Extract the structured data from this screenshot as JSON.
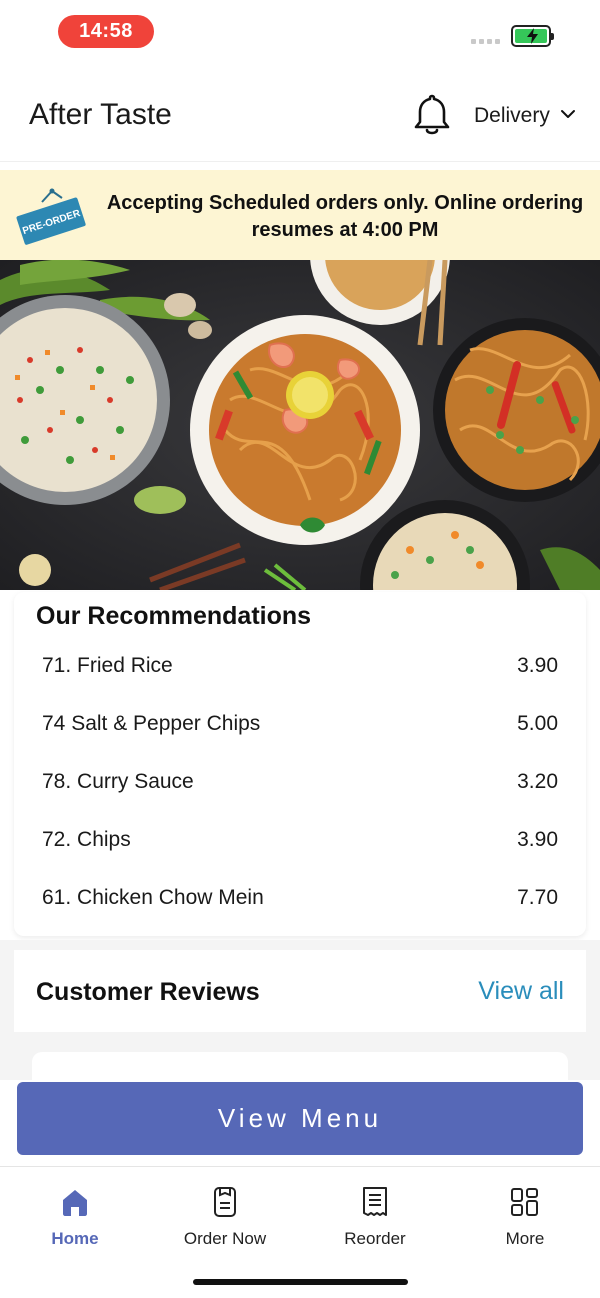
{
  "status_bar": {
    "time": "14:58",
    "battery_icon": "battery-charging-icon"
  },
  "header": {
    "title": "After Taste",
    "bell_icon": "bell-icon",
    "delivery_label": "Delivery",
    "chevron_icon": "chevron-down-icon"
  },
  "banner": {
    "tag_label": "PRE-ORDER",
    "message": "Accepting Scheduled orders only. Online ordering resumes at 4:00 PM"
  },
  "recommendations": {
    "title": "Our Recommendations",
    "items": [
      {
        "name": "71. Fried Rice",
        "price": "3.90"
      },
      {
        "name": "74 Salt & Pepper Chips",
        "price": "5.00"
      },
      {
        "name": "78. Curry Sauce",
        "price": "3.20"
      },
      {
        "name": "72. Chips",
        "price": "3.90"
      },
      {
        "name": "61. Chicken Chow Mein",
        "price": "7.70"
      }
    ]
  },
  "reviews": {
    "title": "Customer Reviews",
    "view_all": "View all"
  },
  "actions": {
    "view_menu": "View Menu"
  },
  "tabbar": {
    "items": [
      {
        "label": "Home",
        "icon": "home-icon",
        "active": true
      },
      {
        "label": "Order Now",
        "icon": "order-icon",
        "active": false
      },
      {
        "label": "Reorder",
        "icon": "receipt-icon",
        "active": false
      },
      {
        "label": "More",
        "icon": "grid-icon",
        "active": false
      }
    ]
  },
  "colors": {
    "accent": "#5668b7",
    "link": "#2a8dbb",
    "banner_bg": "#fdf5d3",
    "time_pill": "#f0433a",
    "battery_fill": "#35c759"
  }
}
